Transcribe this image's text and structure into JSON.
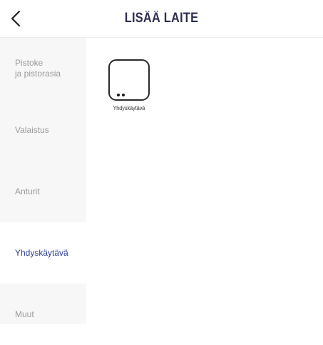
{
  "header": {
    "title": "LISÄÄ LAITE",
    "back_icon": "chevron-left-icon"
  },
  "sidebar": {
    "items": [
      {
        "label": "Pistoke\nja pistorasia",
        "active": false
      },
      {
        "label": "Valaistus",
        "active": false
      },
      {
        "label": "Anturit",
        "active": false
      },
      {
        "label": "Yhdyskäytävä",
        "active": true
      },
      {
        "label": "Muut",
        "active": false
      }
    ]
  },
  "content": {
    "devices": [
      {
        "label": "Yhdyskäytävä",
        "icon": "gateway-device-icon"
      }
    ]
  },
  "colors": {
    "active_text": "#2b3d8f",
    "inactive_text": "#9a9a9a",
    "title_text": "#2e2e4f",
    "sidebar_bg": "#f7f7f7"
  }
}
